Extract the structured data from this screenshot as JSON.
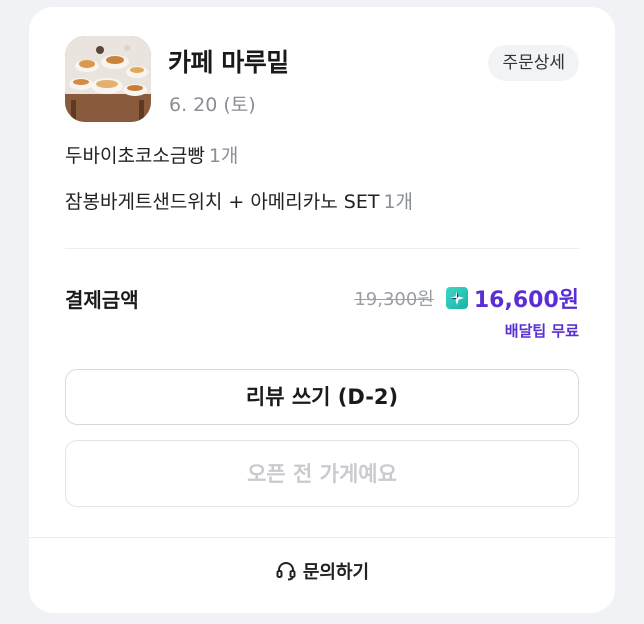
{
  "store": {
    "name": "카페 마루밑",
    "date": "6. 20 (토)",
    "thumbnail_icon": "store-photo-icon"
  },
  "header": {
    "order_detail_label": "주문상세"
  },
  "items": [
    {
      "name": "두바이초코소금빵",
      "qty": "1개"
    },
    {
      "name": "잠봉바게트샌드위치 + 아메리카노 SET",
      "qty": "1개"
    }
  ],
  "payment": {
    "label": "결제금액",
    "original_price": "19,300원",
    "final_price": "16,600원",
    "delivery_note": "배달팁 무료",
    "membership_icon": "plus-star-icon",
    "accent_color": "#5b2ed4"
  },
  "actions": {
    "review_label": "리뷰 쓰기 (D-2)",
    "closed_label": "오픈 전 가게예요"
  },
  "footer": {
    "inquiry_label": "문의하기",
    "inquiry_icon": "headset-icon"
  }
}
